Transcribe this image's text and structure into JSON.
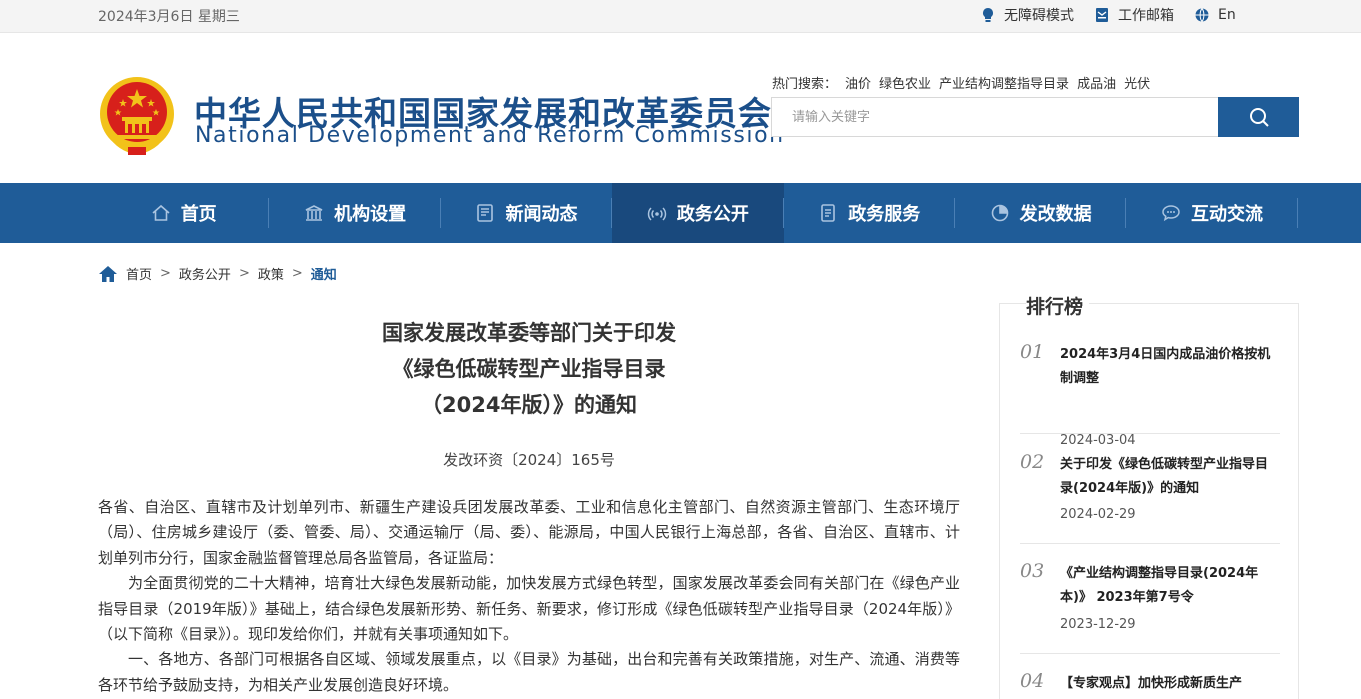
{
  "topbar": {
    "date": "2024年3月6日 星期三",
    "accessibility": "无障碍模式",
    "mail": "工作邮箱",
    "lang": "En"
  },
  "header": {
    "logo_cn": "中华人民共和国国家发展和改革委员会",
    "logo_en": "National Development and Reform Commission",
    "hot_label": "热门搜索：",
    "hot_keywords": [
      "油价",
      "绿色农业",
      "产业结构调整指导目录",
      "成品油",
      "光伏"
    ],
    "search_placeholder": "请输入关键字"
  },
  "nav": {
    "items": [
      {
        "label": "首页",
        "icon": "home-icon"
      },
      {
        "label": "机构设置",
        "icon": "building-icon"
      },
      {
        "label": "新闻动态",
        "icon": "news-icon"
      },
      {
        "label": "政务公开",
        "icon": "broadcast-icon"
      },
      {
        "label": "政务服务",
        "icon": "document-icon"
      },
      {
        "label": "发改数据",
        "icon": "pie-chart-icon"
      },
      {
        "label": "互动交流",
        "icon": "chat-icon"
      }
    ],
    "active_index": 3
  },
  "breadcrumb": {
    "items": [
      "首页",
      "政务公开",
      "政策",
      "通知"
    ],
    "separator": ">"
  },
  "article": {
    "title_lines": [
      "国家发展改革委等部门关于印发",
      "《绿色低碳转型产业指导目录",
      "（2024年版）》的通知"
    ],
    "doc_no": "发改环资〔2024〕165号",
    "paragraphs": [
      "各省、自治区、直辖市及计划单列市、新疆生产建设兵团发展改革委、工业和信息化主管部门、自然资源主管部门、生态环境厅（局）、住房城乡建设厅（委、管委、局）、交通运输厅（局、委）、能源局，中国人民银行上海总部，各省、自治区、直辖市、计划单列市分行，国家金融监督管理总局各监管局，各证监局：",
      "为全面贯彻党的二十大精神，培育壮大绿色发展新动能，加快发展方式绿色转型，国家发展改革委会同有关部门在《绿色产业指导目录（2019年版）》基础上，结合绿色发展新形势、新任务、新要求，修订形成《绿色低碳转型产业指导目录（2024年版）》（以下简称《目录》）。现印发给你们，并就有关事项通知如下。",
      "一、各地方、各部门可根据各自区域、领域发展重点，以《目录》为基础，出台和完善有关政策措施，对生产、流通、消费等各环节给予鼓励支持，为相关产业发展创造良好环境。"
    ]
  },
  "ranking": {
    "title": "排行榜",
    "items": [
      {
        "num": "01",
        "text": "2024年3月4日国内成品油价格按机制调整",
        "date": "2024-03-04"
      },
      {
        "num": "02",
        "text": "关于印发《绿色低碳转型产业指导目录(2024年版)》的通知",
        "date": "2024-02-29"
      },
      {
        "num": "03",
        "text": "《产业结构调整指导目录(2024年本)》 2023年第7号令",
        "date": "2023-12-29"
      },
      {
        "num": "04",
        "text": "【专家观点】加快形成新质生产",
        "date": ""
      }
    ]
  },
  "colors": {
    "brand_blue": "#1f5c98",
    "nav_active": "#19497d",
    "emblem_red": "#d7201b",
    "emblem_gold": "#f2c21a"
  }
}
